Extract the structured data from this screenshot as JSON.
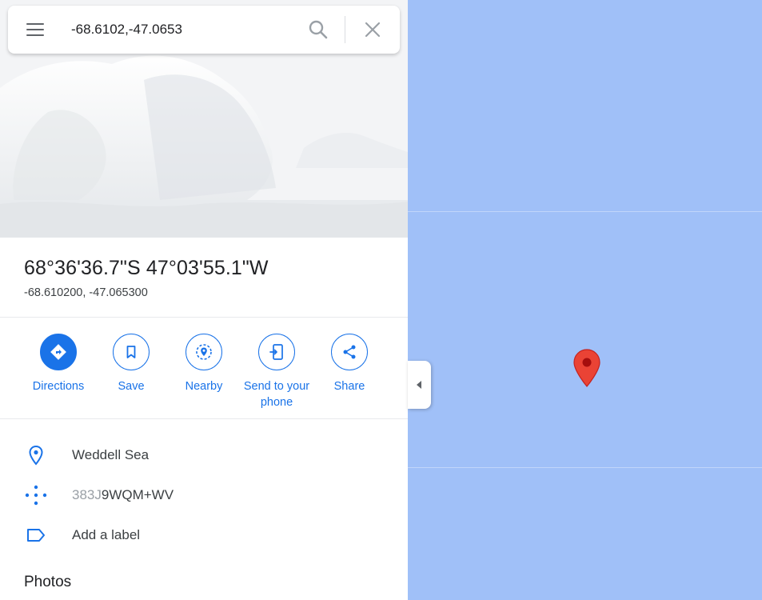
{
  "search": {
    "value": "-68.6102,-47.0653",
    "menu_icon": "hamburger-menu-icon",
    "search_icon": "search-icon",
    "close_icon": "close-icon"
  },
  "place": {
    "title": "68°36'36.7\"S 47°03'55.1\"W",
    "decimal_coords": "-68.610200, -47.065300"
  },
  "actions": [
    {
      "label": "Directions",
      "icon": "directions-icon"
    },
    {
      "label": "Save",
      "icon": "bookmark-icon"
    },
    {
      "label": "Nearby",
      "icon": "nearby-icon"
    },
    {
      "label": "Send to your phone",
      "icon": "send-to-phone-icon"
    },
    {
      "label": "Share",
      "icon": "share-icon"
    }
  ],
  "info": {
    "location": "Weddell Sea",
    "plus_code_prefix": "383J",
    "plus_code_main": "9WQM+WV",
    "add_label": "Add a label"
  },
  "photos_heading": "Photos",
  "colors": {
    "accent": "#1a73e8",
    "map_water": "#a0c0f8",
    "pin": "#ea4335"
  }
}
